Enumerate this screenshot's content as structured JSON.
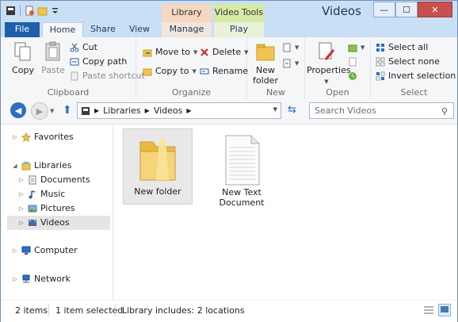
{
  "window": {
    "title": "Videos",
    "minimize": "—",
    "maximize": "☐",
    "close": "✕"
  },
  "contextual_tabs": {
    "library_tools": "Library Tools",
    "video_tools": "Video Tools"
  },
  "tabs": {
    "file": "File",
    "home": "Home",
    "share": "Share",
    "view": "View",
    "manage": "Manage",
    "play": "Play"
  },
  "ribbon": {
    "clipboard": {
      "label": "Clipboard",
      "copy": "Copy",
      "paste": "Paste",
      "cut": "Cut",
      "copy_path": "Copy path",
      "paste_shortcut": "Paste shortcut"
    },
    "organize": {
      "label": "Organize",
      "move_to": "Move to",
      "copy_to": "Copy to",
      "delete": "Delete",
      "rename": "Rename"
    },
    "new": {
      "label": "New",
      "new_folder_line1": "New",
      "new_folder_line2": "folder"
    },
    "open": {
      "label": "Open",
      "properties": "Properties"
    },
    "select": {
      "label": "Select",
      "select_all": "Select all",
      "select_none": "Select none",
      "invert_selection": "Invert selection"
    }
  },
  "address": {
    "root": "Libraries",
    "current": "Videos",
    "search_placeholder": "Search Videos"
  },
  "nav": {
    "favorites": "Favorites",
    "libraries": "Libraries",
    "documents": "Documents",
    "music": "Music",
    "pictures": "Pictures",
    "videos": "Videos",
    "computer": "Computer",
    "network": "Network"
  },
  "files": [
    {
      "name": "New folder",
      "type": "folder"
    },
    {
      "name_line1": "New Text",
      "name_line2": "Document",
      "type": "text"
    }
  ],
  "status": {
    "items": "2 items",
    "selected": "1 item selected",
    "library": "Library includes: 2 locations"
  },
  "colors": {
    "file_tab": "#1f5ea8",
    "title_bar": "#c9dff6",
    "library_tools": "#f6d7c0",
    "video_tools": "#d6e9a7",
    "folder": "#f1c54f"
  }
}
